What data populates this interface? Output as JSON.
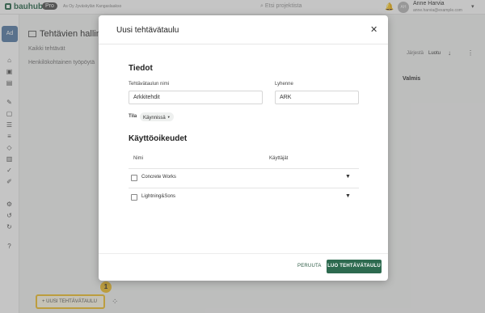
{
  "app": {
    "logo": "bauhub",
    "plan_badge": "Pro",
    "company": "As Oy Jyväskylän Kangaslaakso",
    "search_placeholder": "Etsi projektista",
    "user": {
      "initials": "AH",
      "name": "Anne Harvia",
      "email": "anne.harvia@example.com"
    }
  },
  "sidebar": {
    "account_initials": "Ad"
  },
  "background": {
    "page_title": "Tehtävien hallinta",
    "nav": [
      "Kaikki tehtävät",
      "Henkilökohtainen työpöytä"
    ],
    "sort_label": "Järjestä",
    "sort_value": "Luotu",
    "column_done": "Valmis",
    "new_board_button": "+ UUSI TEHTÄVÄTAULU",
    "callout_number": "1"
  },
  "modal": {
    "title": "Uusi tehtävätaulu",
    "section_info": "Tiedot",
    "name_label": "Tehtävätaulun nimi",
    "name_value": "Arkkitehdit",
    "abbr_label": "Lyhenne",
    "abbr_value": "ARK",
    "status_label": "Tila",
    "status_value": "Käynnissä",
    "section_rights": "Käyttöoikeudet",
    "col_name": "Nimi",
    "col_users": "Käyttäjät",
    "rows": [
      {
        "name": "Concrete Works",
        "checked": false
      },
      {
        "name": "Lightning&Sons",
        "checked": false
      }
    ],
    "cancel_label": "PERUUTA",
    "create_label": "LUO TEHTÄVÄTAULU"
  },
  "colors": {
    "primary": "#2d6a4f",
    "highlight": "#f1c232",
    "overlay": "#5a5a5a"
  }
}
